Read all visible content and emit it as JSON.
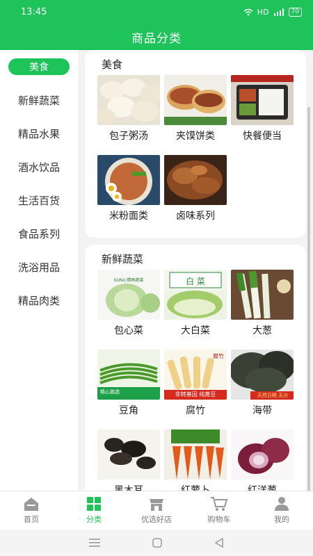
{
  "status": {
    "time": "13:45",
    "network": "HD",
    "signal": "4G",
    "battery": "70"
  },
  "header": {
    "title": "商品分类"
  },
  "sidebar": {
    "items": [
      {
        "label": "美食"
      },
      {
        "label": "新鲜蔬菜"
      },
      {
        "label": "精品水果"
      },
      {
        "label": "酒水饮品"
      },
      {
        "label": "生活百货"
      },
      {
        "label": "食品系列"
      },
      {
        "label": "洗浴用品"
      },
      {
        "label": "精品肉类"
      }
    ]
  },
  "sections": [
    {
      "title": "美食",
      "items": [
        {
          "label": "包子粥汤"
        },
        {
          "label": "夹馍饼类"
        },
        {
          "label": "快餐便当"
        },
        {
          "label": "米粉面类"
        },
        {
          "label": "卤味系列"
        }
      ]
    },
    {
      "title": "新鲜蔬菜",
      "items": [
        {
          "label": "包心菜",
          "img_text": "SUN心情再蔬菜"
        },
        {
          "label": "大白菜",
          "img_text": "白 菜"
        },
        {
          "label": "大葱"
        },
        {
          "label": "豆角",
          "img_text": "精心挑选"
        },
        {
          "label": "腐竹",
          "img_text": "非转基因 纯黄豆",
          "img_text2": "腐竹"
        },
        {
          "label": "海带",
          "img_text": "天然日晒 无沙"
        },
        {
          "label": "黑木耳"
        },
        {
          "label": "红萝卜"
        },
        {
          "label": "红洋葱"
        }
      ]
    }
  ],
  "tabbar": {
    "items": [
      {
        "label": "首页"
      },
      {
        "label": "分类"
      },
      {
        "label": "优选好店"
      },
      {
        "label": "购物车"
      },
      {
        "label": "我的"
      }
    ]
  },
  "colors": {
    "accent": "#1ec35a"
  }
}
